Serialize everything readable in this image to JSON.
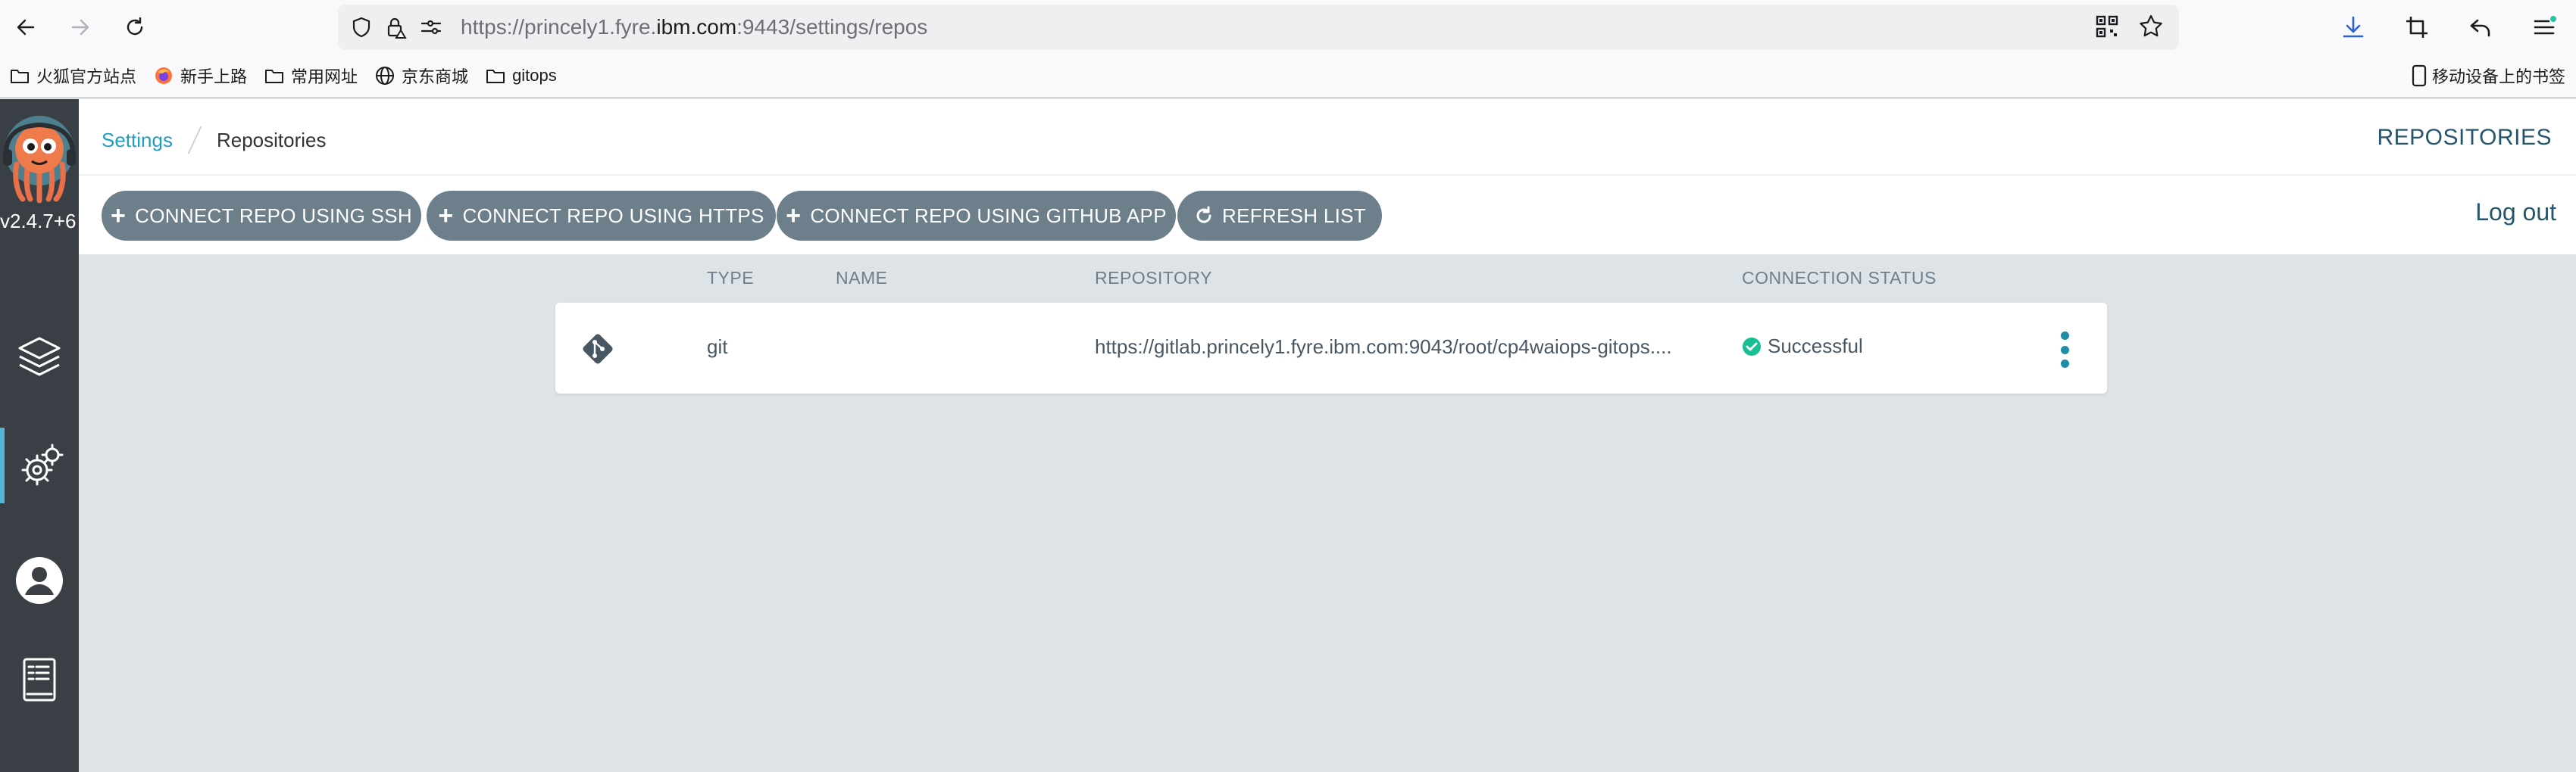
{
  "browser": {
    "url_prefix": "https://princely1.fyre.",
    "url_domain": "ibm.com",
    "url_suffix": ":9443/settings/repos",
    "bookmarks": [
      "火狐官方站点",
      "新手上路",
      "常用网址",
      "京东商城",
      "gitops"
    ],
    "mobile_bookmarks": "移动设备上的书签"
  },
  "sidebar": {
    "version": "v2.4.7+6"
  },
  "header": {
    "breadcrumb_settings": "Settings",
    "breadcrumb_current": "Repositories",
    "title": "REPOSITORIES"
  },
  "actions": {
    "connect_ssh": "CONNECT REPO USING SSH",
    "connect_https": "CONNECT REPO USING HTTPS",
    "connect_github_app": "CONNECT REPO USING GITHUB APP",
    "refresh": "REFRESH LIST",
    "logout": "Log out"
  },
  "table": {
    "columns": [
      "TYPE",
      "NAME",
      "REPOSITORY",
      "CONNECTION STATUS"
    ],
    "rows": [
      {
        "type": "git",
        "name": "",
        "repository": "https://gitlab.princely1.fyre.ibm.com:9043/root/cp4waiops-gitops....",
        "status": "Successful"
      }
    ]
  },
  "colors": {
    "accent": "#209fbd",
    "button": "#6d7f8b",
    "success": "#18be94",
    "sidebar": "#3a3f45"
  }
}
